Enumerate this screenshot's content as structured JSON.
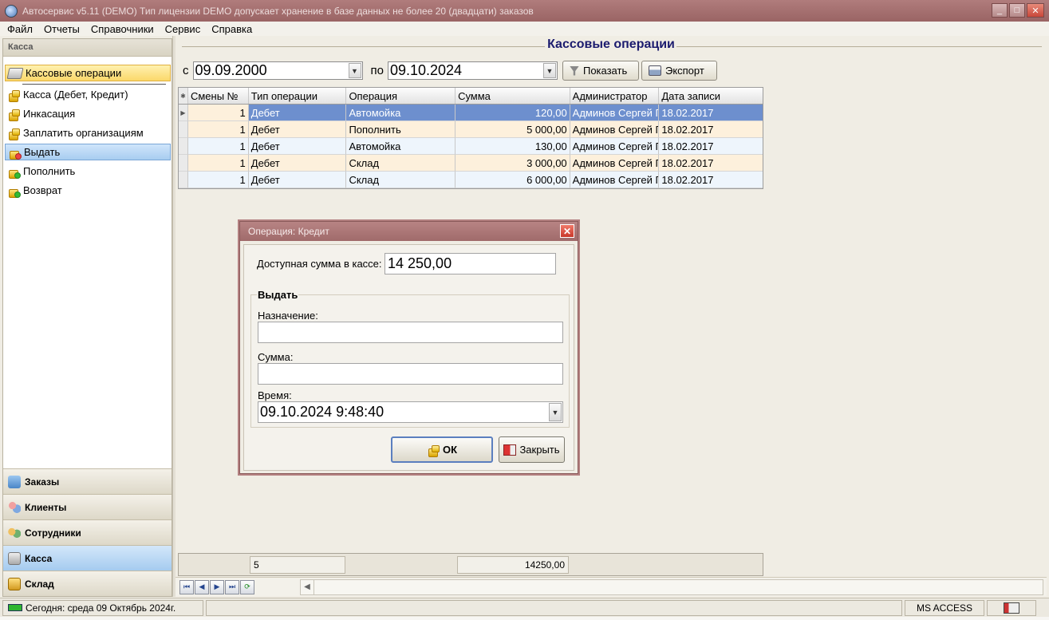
{
  "window": {
    "title": "Автосервис v5.11 (DEMO) Тип лицензии DEMO допускает хранение в базе данных не более 20 (двадцати) заказов",
    "controls": [
      "_",
      "□",
      "✕"
    ]
  },
  "menu": [
    "Файл",
    "Отчеты",
    "Справочники",
    "Сервис",
    "Справка"
  ],
  "sidebar": {
    "header": "Касса",
    "items": [
      {
        "label": "Кассовые операции",
        "icon": "cash-register-icon"
      },
      {
        "label": "Касса (Дебет, Кредит)",
        "icon": "coins-icon"
      },
      {
        "label": "Инкасация",
        "icon": "coins-icon"
      },
      {
        "label": "Заплатить организациям",
        "icon": "coins-icon"
      },
      {
        "label": "Выдать",
        "icon": "coins-remove-icon"
      },
      {
        "label": "Пополнить",
        "icon": "coins-add-icon"
      },
      {
        "label": "Возврат",
        "icon": "coins-return-icon"
      }
    ],
    "groups": [
      {
        "label": "Заказы",
        "icon": "orders-icon"
      },
      {
        "label": "Клиенты",
        "icon": "clients-icon"
      },
      {
        "label": "Сотрудники",
        "icon": "staff-icon"
      },
      {
        "label": "Касса",
        "icon": "cash-icon"
      },
      {
        "label": "Склад",
        "icon": "warehouse-icon"
      }
    ]
  },
  "main": {
    "title": "Кассовые операции",
    "filter": {
      "from_label": "с",
      "from_date": "09.09.2000",
      "to_label": "по",
      "to_date": "09.10.2024",
      "show_button": "Показать",
      "export_button": "Экспорт"
    },
    "grid": {
      "columns": [
        "Смены №",
        "Тип операции",
        "Операция",
        "Сумма",
        "Администратор",
        "Дата записи"
      ],
      "rows": [
        [
          "1",
          "Дебет",
          "Автомойка",
          "120,00",
          "Админов Сергей Г",
          "18.02.2017"
        ],
        [
          "1",
          "Дебет",
          "Пополнить",
          "5 000,00",
          "Админов Сергей Г",
          "18.02.2017"
        ],
        [
          "1",
          "Дебет",
          "Автомойка",
          "130,00",
          "Админов Сергей Г",
          "18.02.2017"
        ],
        [
          "1",
          "Дебет",
          "Склад",
          "3 000,00",
          "Админов Сергей Г",
          "18.02.2017"
        ],
        [
          "1",
          "Дебет",
          "Склад",
          "6 000,00",
          "Админов Сергей Г",
          "18.02.2017"
        ]
      ],
      "selected_row": 0
    },
    "summary": {
      "count": "5",
      "total": "14250,00"
    }
  },
  "dialog": {
    "title": "Операция: Кредит",
    "available_label": "Доступная сумма в кассе:",
    "available_value": "14 250,00",
    "group_title": "Выдать",
    "purpose_label": "Назначение:",
    "purpose_value": "",
    "amount_label": "Сумма:",
    "amount_value": "",
    "time_label": "Время:",
    "time_value": "09.10.2024 9:48:40",
    "ok_button": "ОК",
    "close_button": "Закрыть"
  },
  "statusbar": {
    "today": "Сегодня: среда 09 Октябрь 2024г.",
    "db": "MS ACCESS"
  }
}
